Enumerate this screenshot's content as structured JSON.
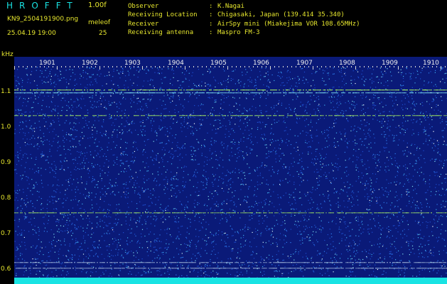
{
  "header": {
    "app_title": "HROFFT",
    "version": "1.00f",
    "filename": "KN9_2504191900.png",
    "datetime": "25.04.19 19:00",
    "param_label": "meleof",
    "param_value": "25"
  },
  "info": [
    {
      "key": "Observer",
      "value": "K.Nagai"
    },
    {
      "key": "Receiving Location",
      "value": "Chigasaki, Japan (139.414 35.340)"
    },
    {
      "key": "Receiver",
      "value": "AirSpy mini (Miakejima VOR 108.65MHz)"
    },
    {
      "key": "Receiving antenna",
      "value": "Maspro FM-3"
    }
  ],
  "axis": {
    "y_unit": "kHz",
    "y_ticks": [
      "1.1",
      "1.0",
      "0.9",
      "0.8",
      "0.7",
      "0.6"
    ],
    "x_ticks": [
      "1901",
      "1902",
      "1903",
      "1904",
      "1905",
      "1906",
      "1907",
      "1908",
      "1909",
      "1910"
    ]
  },
  "colors": {
    "label": "#e6e62e",
    "title": "#19e3e3",
    "noise_bg": "#0a1a78",
    "signal": "#a8f060",
    "bottom_band": "#19e3e3"
  }
}
